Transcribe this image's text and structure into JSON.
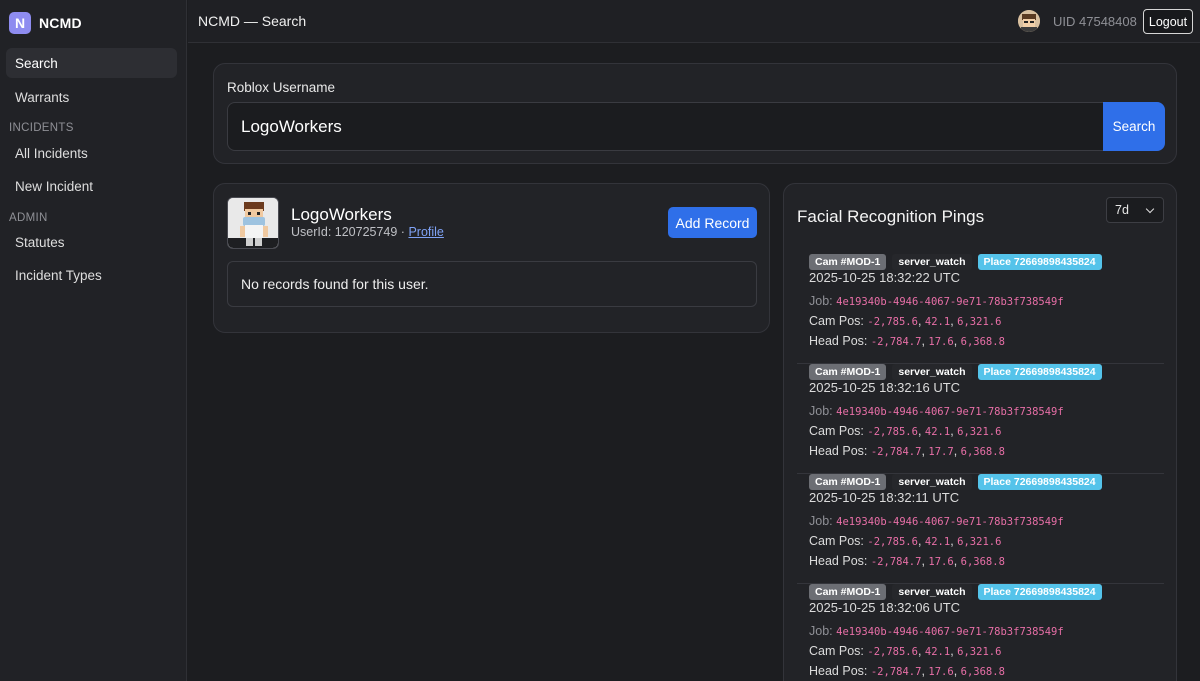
{
  "brand": {
    "logo_letter": "N",
    "name": "NCMD"
  },
  "sidebar": {
    "items": [
      {
        "label": "Search"
      },
      {
        "label": "Warrants"
      },
      {
        "label": "All Incidents"
      },
      {
        "label": "New Incident"
      },
      {
        "label": "Statutes"
      },
      {
        "label": "Incident Types"
      }
    ],
    "sections": [
      "INCIDENTS",
      "ADMIN"
    ]
  },
  "header": {
    "title": "NCMD — Search",
    "uid": "UID 47548408",
    "logout_label": "Logout"
  },
  "search": {
    "label": "Roblox Username",
    "value": "LogoWorkers",
    "button_label": "Search"
  },
  "profile": {
    "username": "LogoWorkers",
    "userid_text": "UserId: 120725749 · ",
    "profile_link": "Profile",
    "add_record_label": "Add Record",
    "empty_message": "No records found for this user."
  },
  "facial": {
    "title": "Facial Recognition Pings",
    "range": "7d",
    "pings": [
      {
        "cam": "Cam #MOD-1",
        "source": "server_watch",
        "place": "Place 72669898435824",
        "time": "2025-10-25 18:32:22 UTC",
        "job_label": "Job:",
        "job": "4e19340b-4946-4067-9e71-78b3f738549f",
        "cam_pos_label": "Cam Pos:",
        "cam_pos": [
          "-2,785.6",
          "42.1",
          "6,321.6"
        ],
        "head_pos_label": "Head Pos:",
        "head_pos": [
          "-2,784.7",
          "17.6",
          "6,368.8"
        ]
      },
      {
        "cam": "Cam #MOD-1",
        "source": "server_watch",
        "place": "Place 72669898435824",
        "time": "2025-10-25 18:32:16 UTC",
        "job_label": "Job:",
        "job": "4e19340b-4946-4067-9e71-78b3f738549f",
        "cam_pos_label": "Cam Pos:",
        "cam_pos": [
          "-2,785.6",
          "42.1",
          "6,321.6"
        ],
        "head_pos_label": "Head Pos:",
        "head_pos": [
          "-2,784.7",
          "17.7",
          "6,368.8"
        ]
      },
      {
        "cam": "Cam #MOD-1",
        "source": "server_watch",
        "place": "Place 72669898435824",
        "time": "2025-10-25 18:32:11 UTC",
        "job_label": "Job:",
        "job": "4e19340b-4946-4067-9e71-78b3f738549f",
        "cam_pos_label": "Cam Pos:",
        "cam_pos": [
          "-2,785.6",
          "42.1",
          "6,321.6"
        ],
        "head_pos_label": "Head Pos:",
        "head_pos": [
          "-2,784.7",
          "17.6",
          "6,368.8"
        ]
      },
      {
        "cam": "Cam #MOD-1",
        "source": "server_watch",
        "place": "Place 72669898435824",
        "time": "2025-10-25 18:32:06 UTC",
        "job_label": "Job:",
        "job": "4e19340b-4946-4067-9e71-78b3f738549f",
        "cam_pos_label": "Cam Pos:",
        "cam_pos": [
          "-2,785.6",
          "42.1",
          "6,321.6"
        ],
        "head_pos_label": "Head Pos:",
        "head_pos": [
          "-2,784.7",
          "17.6",
          "6,368.8"
        ]
      }
    ]
  },
  "colors": {
    "accent": "#2f6fe9",
    "brand": "#8e8cf0",
    "place_badge": "#54c3ea",
    "mono_value": "#e86fa7"
  }
}
